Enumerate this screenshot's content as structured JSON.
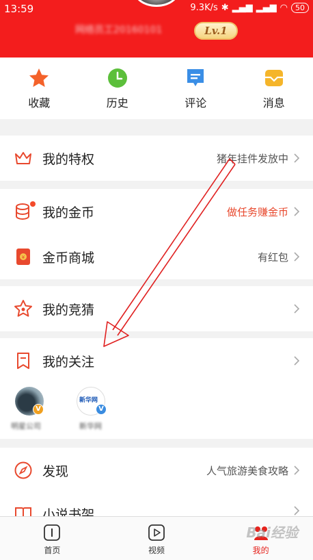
{
  "status_bar": {
    "time": "13:59",
    "network_speed": "9.3K/s",
    "battery": "50"
  },
  "profile": {
    "username": "网络员工20160101",
    "level": "Lv.1"
  },
  "quick_actions": [
    {
      "label": "收藏",
      "icon": "star-icon",
      "color": "#f4622a"
    },
    {
      "label": "历史",
      "icon": "clock-icon",
      "color": "#5cbf3b"
    },
    {
      "label": "评论",
      "icon": "comment-icon",
      "color": "#3a8ee6"
    },
    {
      "label": "消息",
      "icon": "message-icon",
      "color": "#f5b52a"
    }
  ],
  "menu": {
    "privilege": {
      "label": "我的特权",
      "value": "猪年挂件发放中"
    },
    "coins": {
      "label": "我的金币",
      "value": "做任务赚金币"
    },
    "coin_mall": {
      "label": "金币商城",
      "value": "有红包"
    },
    "guess": {
      "label": "我的竞猜",
      "value": ""
    },
    "follows": {
      "label": "我的关注",
      "accounts": [
        {
          "name": "明星公司"
        },
        {
          "name": "新华网",
          "logo_text": "新华网"
        }
      ]
    },
    "discover": {
      "label": "发现",
      "value": "人气旅游美食攻略"
    },
    "novel": {
      "label": "小说书架",
      "value": ""
    }
  },
  "bottom_nav": [
    {
      "label": "首页",
      "icon": "home-icon"
    },
    {
      "label": "视频",
      "icon": "video-play-icon"
    },
    {
      "label": "我的",
      "icon": "profile-icon",
      "active": true
    }
  ],
  "watermark": "Bai经验",
  "colors": {
    "brand_red": "#f31d1d",
    "accent_orange": "#e8492e",
    "level_gold": "#f0c068"
  }
}
